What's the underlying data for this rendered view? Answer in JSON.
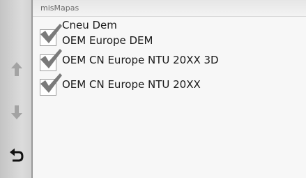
{
  "header": {
    "title": "misMapas"
  },
  "sidebar": {
    "up_icon": "arrow-up-icon",
    "down_icon": "arrow-down-icon",
    "back_icon": "back-arrow-icon"
  },
  "maps": [
    {
      "lines": [
        "Cneu Dem",
        "OEM Europe DEM"
      ],
      "checked": true
    },
    {
      "lines": [
        "OEM CN Europe NTU 20XX 3D"
      ],
      "checked": true
    },
    {
      "lines": [
        "OEM CN Europe NTU 20XX"
      ],
      "checked": true
    }
  ],
  "colors": {
    "checkmark": "#7a7a7a",
    "arrow_disabled": "#a3a3a3",
    "back_arrow": "#111111"
  }
}
